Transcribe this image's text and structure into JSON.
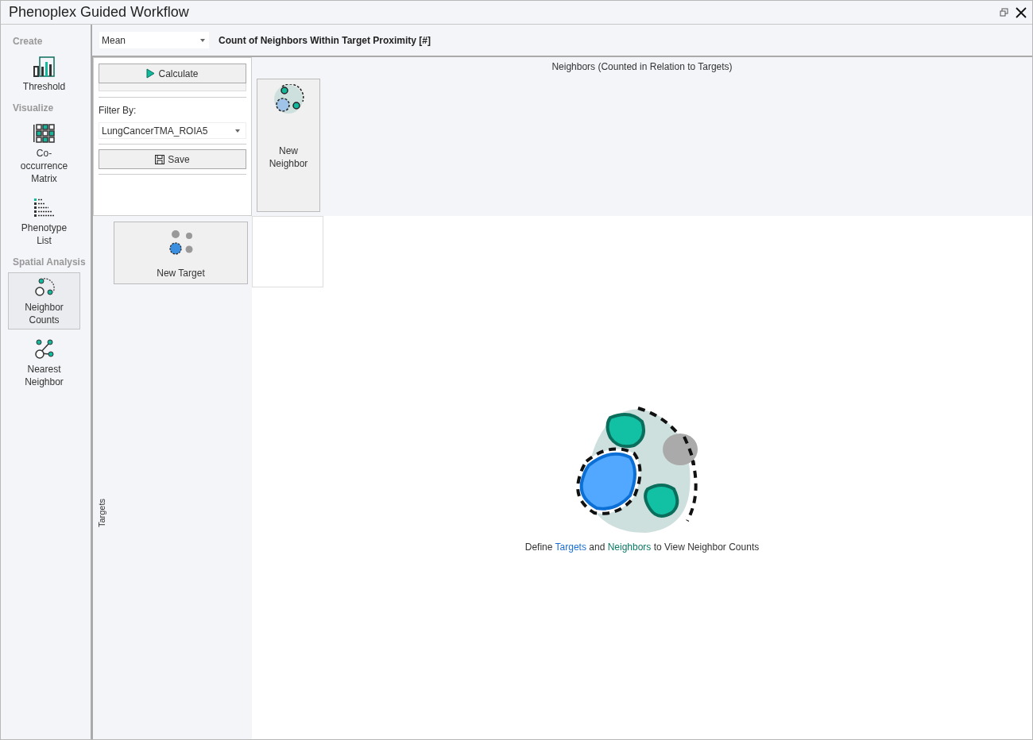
{
  "window": {
    "title": "Phenoplex Guided Workflow"
  },
  "sidebar": {
    "sections": [
      {
        "heading": "Create",
        "items": [
          {
            "label": "Threshold",
            "kind": "threshold",
            "selected": false
          }
        ]
      },
      {
        "heading": "Visualize",
        "items": [
          {
            "label": "Co-occurrence Matrix",
            "kind": "matrix",
            "selected": false
          },
          {
            "label": "Phenotype List",
            "kind": "list",
            "selected": false
          }
        ]
      },
      {
        "heading": "Spatial Analysis",
        "items": [
          {
            "label": "Neighbor Counts",
            "kind": "counts",
            "selected": true
          },
          {
            "label": "Nearest Neighbor",
            "kind": "nearest",
            "selected": false
          }
        ]
      }
    ]
  },
  "toolbar": {
    "statistic": "Mean",
    "title": "Count of Neighbors Within Target Proximity [#]"
  },
  "controls": {
    "calculate": "Calculate",
    "progress": {
      "level": 0
    },
    "filter_label": "Filter By:",
    "filter_value": "LungCancerTMA_ROIA5",
    "save": "Save"
  },
  "neighbors_header": "Neighbors (Counted in Relation to Targets)",
  "new_neighbor": "New Neighbor",
  "new_target": "New Target",
  "targets_label": "Targets",
  "empty_message": [
    {
      "text": "Define ",
      "kind": "plain"
    },
    {
      "text": "Targets",
      "kind": "target"
    },
    {
      "text": " and ",
      "kind": "plain"
    },
    {
      "text": "Neighbors",
      "kind": "neighbor"
    },
    {
      "text": " to View Neighbor Counts",
      "kind": "plain"
    }
  ]
}
